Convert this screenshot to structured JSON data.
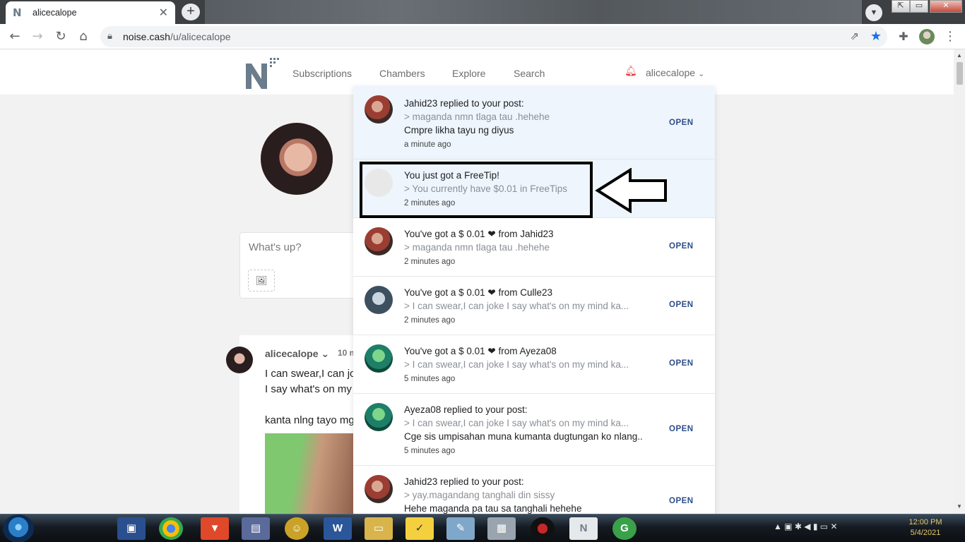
{
  "browser": {
    "tab_title": "alicecalope",
    "tab_favicon": "N",
    "tab_close": "✕",
    "new_tab": "+",
    "url_host": "noise.cash",
    "url_path": "/u/alicecalope"
  },
  "nav": {
    "links": [
      "Subscriptions",
      "Chambers",
      "Explore",
      "Search"
    ],
    "username": "alicecalope"
  },
  "composer": {
    "placeholder": "What's up?"
  },
  "post": {
    "author": "alicecalope",
    "time": "10 m",
    "lines": [
      "I can swear,I can jo",
      "I say what's on my",
      "kanta nlng tayo mg"
    ]
  },
  "notifications": [
    {
      "title": "Jahid23 replied to your post:",
      "quote": "> maganda nmn tlaga tau .hehehe",
      "message": "Cmpre likha tayu ng diyus",
      "time": "a minute ago",
      "action": "OPEN"
    },
    {
      "title": "You just got a FreeTip!",
      "quote": "> You currently have $0.01 in FreeTips",
      "time": "2 minutes ago"
    },
    {
      "title": "You've got a $ 0.01 ❤ from Jahid23",
      "quote": "> maganda nmn tlaga tau .hehehe",
      "time": "2 minutes ago",
      "action": "OPEN"
    },
    {
      "title": "You've got a $ 0.01 ❤ from Culle23",
      "quote": "> I can swear,I can joke I say what's on my mind ka...",
      "time": "2 minutes ago",
      "action": "OPEN"
    },
    {
      "title": "You've got a $ 0.01 ❤ from Ayeza08",
      "quote": "> I can swear,I can joke I say what's on my mind ka...",
      "time": "5 minutes ago",
      "action": "OPEN"
    },
    {
      "title": "Ayeza08 replied to your post:",
      "quote": "> I can swear,I can joke I say what's on my mind ka...",
      "message": "Cge sis umpisahan muna kumanta dugtungan ko nlang..",
      "time": "5 minutes ago",
      "action": "OPEN"
    },
    {
      "title": "Jahid23 replied to your post:",
      "quote": "> yay.magandang tanghali din sissy",
      "message": "Hehe maganda pa tau sa tanghali hehehe",
      "action": "OPEN"
    }
  ],
  "taskbar": {
    "time": "12:00 PM",
    "date": "5/4/2021"
  },
  "colors": {
    "accent_blue": "#2d4d8a",
    "unread_bg": "#eef5fc",
    "bell_red": "#e53935",
    "bookmark_star": "#1a73e8"
  }
}
